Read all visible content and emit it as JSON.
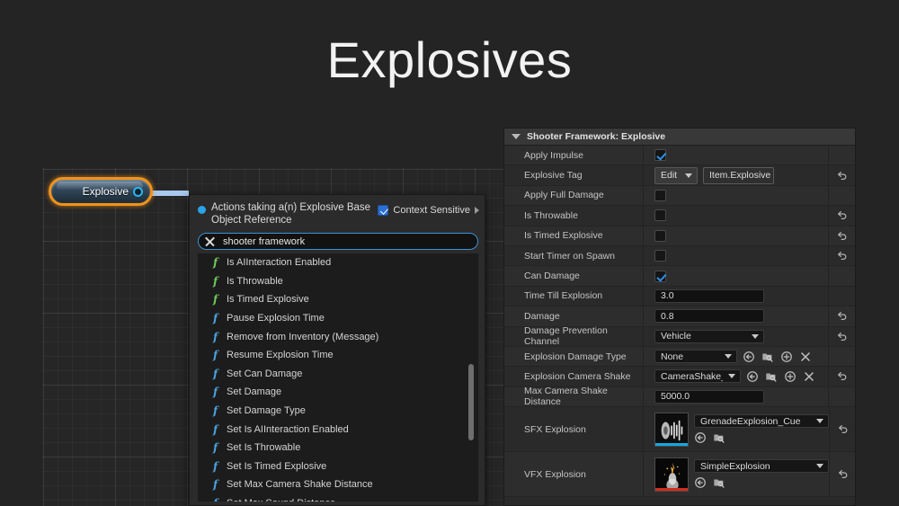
{
  "page": {
    "title": "Explosives"
  },
  "graph": {
    "node": {
      "label": "Explosive",
      "pin_name": "object-reference-pin",
      "border_color": "#f0921b",
      "pin_color": "#29b6f2"
    }
  },
  "action_menu": {
    "title": "Actions taking a(n) Explosive Base Object Reference",
    "context_sensitive_label": "Context Sensitive",
    "context_sensitive_checked": true,
    "search_value": "shooter framework",
    "search_clear_icon": "close-icon",
    "items": [
      {
        "label": "Is AIInteraction Enabled",
        "kind": "pure"
      },
      {
        "label": "Is Throwable",
        "kind": "pure"
      },
      {
        "label": "Is Timed Explosive",
        "kind": "pure"
      },
      {
        "label": "Pause Explosion Time",
        "kind": "call"
      },
      {
        "label": "Remove from Inventory (Message)",
        "kind": "call"
      },
      {
        "label": "Resume Explosion Time",
        "kind": "call"
      },
      {
        "label": "Set Can Damage",
        "kind": "call"
      },
      {
        "label": "Set Damage",
        "kind": "call"
      },
      {
        "label": "Set Damage Type",
        "kind": "call"
      },
      {
        "label": "Set Is AIInteraction Enabled",
        "kind": "call"
      },
      {
        "label": "Set Is Throwable",
        "kind": "call"
      },
      {
        "label": "Set Is Timed Explosive",
        "kind": "call"
      },
      {
        "label": "Set Max Camera Shake Distance",
        "kind": "call"
      },
      {
        "label": "Set Max Sound Distance",
        "kind": "call"
      }
    ]
  },
  "details": {
    "header": "Shooter Framework: Explosive",
    "rows": [
      {
        "name": "Apply Impulse",
        "type": "checkbox",
        "checked": true,
        "revert": false
      },
      {
        "name": "Explosive Tag",
        "type": "tag",
        "edit_label": "Edit",
        "value": "Item.Explosive",
        "revert": true
      },
      {
        "name": "Apply Full Damage",
        "type": "checkbox",
        "checked": false,
        "revert": false
      },
      {
        "name": "Is Throwable",
        "type": "checkbox",
        "checked": false,
        "revert": true
      },
      {
        "name": "Is Timed Explosive",
        "type": "checkbox",
        "checked": false,
        "revert": true
      },
      {
        "name": "Start Timer on Spawn",
        "type": "checkbox",
        "checked": false,
        "revert": true
      },
      {
        "name": "Can Damage",
        "type": "checkbox",
        "checked": true,
        "revert": false
      },
      {
        "name": "Time Till Explosion",
        "type": "text",
        "value": "3.0",
        "revert": false
      },
      {
        "name": "Damage",
        "type": "text",
        "value": "0.8",
        "revert": true
      },
      {
        "name": "Damage Prevention Channel",
        "type": "dropdown",
        "value": "Vehicle",
        "revert": true
      },
      {
        "name": "Explosion Damage Type",
        "type": "asset",
        "value": "None",
        "revert": false,
        "icons": [
          "use-selected-icon",
          "browse-icon",
          "new-asset-icon",
          "clear-icon"
        ]
      },
      {
        "name": "Explosion Camera Shake",
        "type": "asset",
        "value": "CameraShake_Explo",
        "revert": true,
        "icons": [
          "use-selected-icon",
          "browse-icon",
          "new-asset-icon",
          "clear-icon"
        ]
      },
      {
        "name": "Max Camera Shake Distance",
        "type": "text",
        "value": "5000.0",
        "revert": false
      },
      {
        "name": "SFX Explosion",
        "type": "thumb-asset",
        "value": "GrenadeExplosion_Cue",
        "thumb": "sound-cue-thumbnail",
        "bar": "#13a9e0",
        "revert": true,
        "icons": [
          "use-selected-icon",
          "browse-icon"
        ]
      },
      {
        "name": "VFX Explosion",
        "type": "thumb-asset",
        "value": "SimpleExplosion",
        "thumb": "particle-system-thumbnail",
        "bar": "#d62a1e",
        "revert": true,
        "icons": [
          "use-selected-icon",
          "browse-icon"
        ]
      }
    ]
  }
}
